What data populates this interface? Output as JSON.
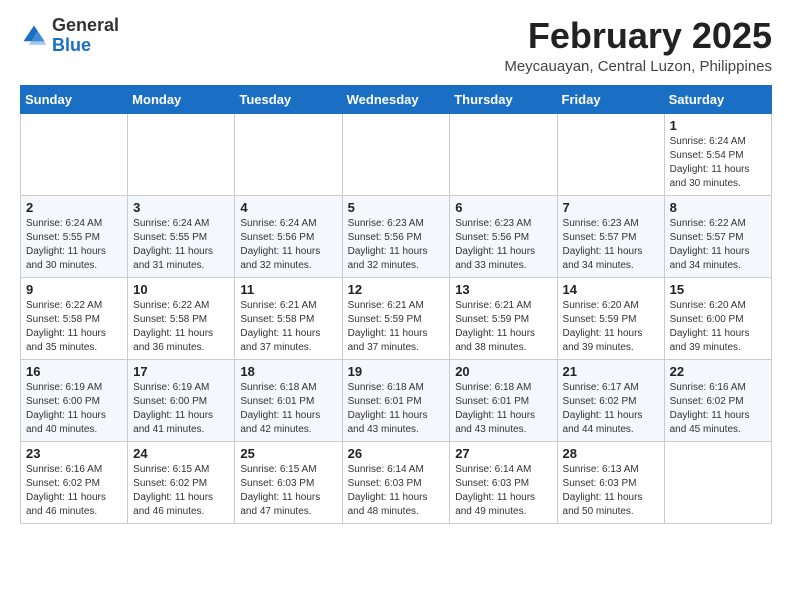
{
  "header": {
    "logo": {
      "general": "General",
      "blue": "Blue"
    },
    "month_year": "February 2025",
    "location": "Meycauayan, Central Luzon, Philippines"
  },
  "days_of_week": [
    "Sunday",
    "Monday",
    "Tuesday",
    "Wednesday",
    "Thursday",
    "Friday",
    "Saturday"
  ],
  "weeks": [
    [
      {
        "day": "",
        "info": ""
      },
      {
        "day": "",
        "info": ""
      },
      {
        "day": "",
        "info": ""
      },
      {
        "day": "",
        "info": ""
      },
      {
        "day": "",
        "info": ""
      },
      {
        "day": "",
        "info": ""
      },
      {
        "day": "1",
        "info": "Sunrise: 6:24 AM\nSunset: 5:54 PM\nDaylight: 11 hours and 30 minutes."
      }
    ],
    [
      {
        "day": "2",
        "info": "Sunrise: 6:24 AM\nSunset: 5:55 PM\nDaylight: 11 hours and 30 minutes."
      },
      {
        "day": "3",
        "info": "Sunrise: 6:24 AM\nSunset: 5:55 PM\nDaylight: 11 hours and 31 minutes."
      },
      {
        "day": "4",
        "info": "Sunrise: 6:24 AM\nSunset: 5:56 PM\nDaylight: 11 hours and 32 minutes."
      },
      {
        "day": "5",
        "info": "Sunrise: 6:23 AM\nSunset: 5:56 PM\nDaylight: 11 hours and 32 minutes."
      },
      {
        "day": "6",
        "info": "Sunrise: 6:23 AM\nSunset: 5:56 PM\nDaylight: 11 hours and 33 minutes."
      },
      {
        "day": "7",
        "info": "Sunrise: 6:23 AM\nSunset: 5:57 PM\nDaylight: 11 hours and 34 minutes."
      },
      {
        "day": "8",
        "info": "Sunrise: 6:22 AM\nSunset: 5:57 PM\nDaylight: 11 hours and 34 minutes."
      }
    ],
    [
      {
        "day": "9",
        "info": "Sunrise: 6:22 AM\nSunset: 5:58 PM\nDaylight: 11 hours and 35 minutes."
      },
      {
        "day": "10",
        "info": "Sunrise: 6:22 AM\nSunset: 5:58 PM\nDaylight: 11 hours and 36 minutes."
      },
      {
        "day": "11",
        "info": "Sunrise: 6:21 AM\nSunset: 5:58 PM\nDaylight: 11 hours and 37 minutes."
      },
      {
        "day": "12",
        "info": "Sunrise: 6:21 AM\nSunset: 5:59 PM\nDaylight: 11 hours and 37 minutes."
      },
      {
        "day": "13",
        "info": "Sunrise: 6:21 AM\nSunset: 5:59 PM\nDaylight: 11 hours and 38 minutes."
      },
      {
        "day": "14",
        "info": "Sunrise: 6:20 AM\nSunset: 5:59 PM\nDaylight: 11 hours and 39 minutes."
      },
      {
        "day": "15",
        "info": "Sunrise: 6:20 AM\nSunset: 6:00 PM\nDaylight: 11 hours and 39 minutes."
      }
    ],
    [
      {
        "day": "16",
        "info": "Sunrise: 6:19 AM\nSunset: 6:00 PM\nDaylight: 11 hours and 40 minutes."
      },
      {
        "day": "17",
        "info": "Sunrise: 6:19 AM\nSunset: 6:00 PM\nDaylight: 11 hours and 41 minutes."
      },
      {
        "day": "18",
        "info": "Sunrise: 6:18 AM\nSunset: 6:01 PM\nDaylight: 11 hours and 42 minutes."
      },
      {
        "day": "19",
        "info": "Sunrise: 6:18 AM\nSunset: 6:01 PM\nDaylight: 11 hours and 43 minutes."
      },
      {
        "day": "20",
        "info": "Sunrise: 6:18 AM\nSunset: 6:01 PM\nDaylight: 11 hours and 43 minutes."
      },
      {
        "day": "21",
        "info": "Sunrise: 6:17 AM\nSunset: 6:02 PM\nDaylight: 11 hours and 44 minutes."
      },
      {
        "day": "22",
        "info": "Sunrise: 6:16 AM\nSunset: 6:02 PM\nDaylight: 11 hours and 45 minutes."
      }
    ],
    [
      {
        "day": "23",
        "info": "Sunrise: 6:16 AM\nSunset: 6:02 PM\nDaylight: 11 hours and 46 minutes."
      },
      {
        "day": "24",
        "info": "Sunrise: 6:15 AM\nSunset: 6:02 PM\nDaylight: 11 hours and 46 minutes."
      },
      {
        "day": "25",
        "info": "Sunrise: 6:15 AM\nSunset: 6:03 PM\nDaylight: 11 hours and 47 minutes."
      },
      {
        "day": "26",
        "info": "Sunrise: 6:14 AM\nSunset: 6:03 PM\nDaylight: 11 hours and 48 minutes."
      },
      {
        "day": "27",
        "info": "Sunrise: 6:14 AM\nSunset: 6:03 PM\nDaylight: 11 hours and 49 minutes."
      },
      {
        "day": "28",
        "info": "Sunrise: 6:13 AM\nSunset: 6:03 PM\nDaylight: 11 hours and 50 minutes."
      },
      {
        "day": "",
        "info": ""
      }
    ]
  ]
}
